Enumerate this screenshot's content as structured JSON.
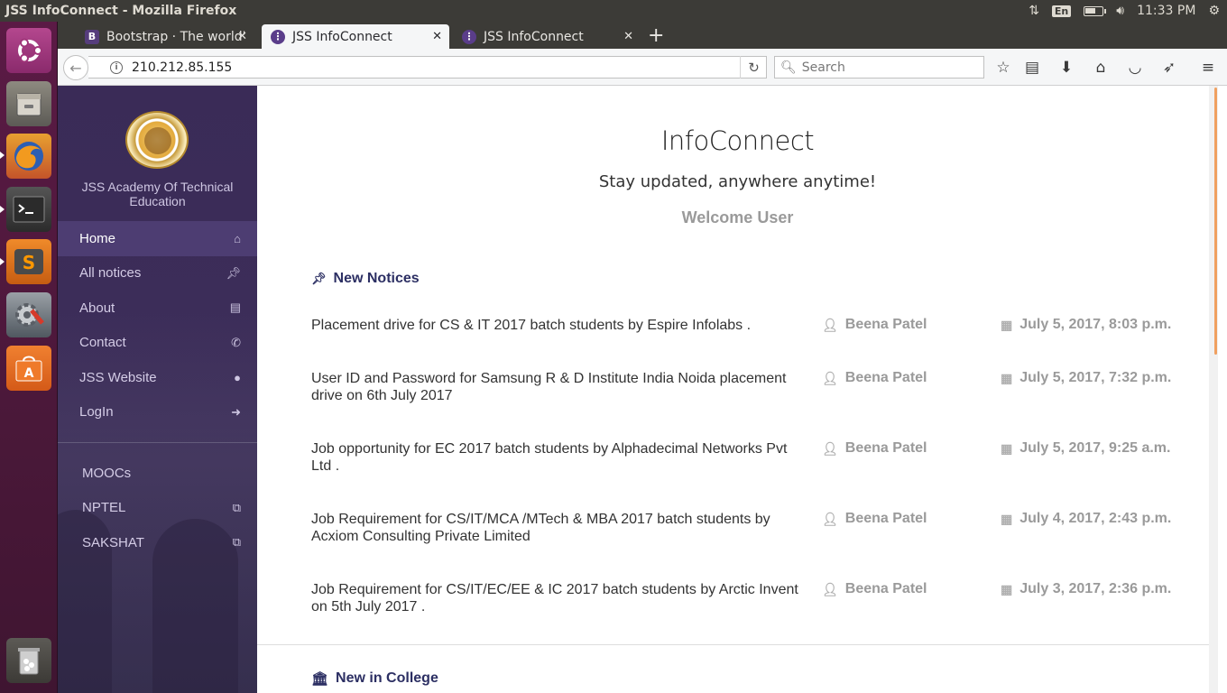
{
  "os_panel": {
    "window_title": "JSS InfoConnect - Mozilla Firefox",
    "keyboard_layout": "En",
    "battery_level": 0.7,
    "clock": "11:33 PM"
  },
  "launcher": {
    "items": [
      "ubuntu-dash",
      "files",
      "firefox",
      "terminal",
      "sublime-text",
      "system-settings",
      "software-center",
      "trash"
    ]
  },
  "browser": {
    "tabs": [
      {
        "label": "Bootstrap · The world'",
        "favicon": "B",
        "favicon_color": "#563d7c",
        "active": false
      },
      {
        "label": "JSS InfoConnect",
        "favicon": "",
        "favicon_color": "#5a3d8a",
        "active": true
      },
      {
        "label": "JSS InfoConnect",
        "favicon": "",
        "favicon_color": "#5a3d8a",
        "active": false
      }
    ],
    "url": "210.212.85.155",
    "search_placeholder": "Search"
  },
  "sidebar": {
    "institution": "JSS Academy Of Technical Education",
    "nav": [
      {
        "label": "Home",
        "icon": "home-icon",
        "active": true
      },
      {
        "label": "All notices",
        "icon": "pin-icon",
        "active": false
      },
      {
        "label": "About",
        "icon": "newspaper-icon",
        "active": false
      },
      {
        "label": "Contact",
        "icon": "phone-icon",
        "active": false
      },
      {
        "label": "JSS Website",
        "icon": "globe-icon",
        "active": false
      },
      {
        "label": "LogIn",
        "icon": "sign-in-icon",
        "active": false
      }
    ],
    "external": [
      {
        "label": "MOOCs",
        "icon": ""
      },
      {
        "label": "NPTEL",
        "icon": "external-link-icon"
      },
      {
        "label": "SAKSHAT",
        "icon": "external-link-icon"
      }
    ]
  },
  "main": {
    "brand": "InfoConnect",
    "tagline": "Stay updated, anywhere anytime!",
    "welcome": "Welcome User",
    "new_notices_heading": "New Notices",
    "notices": [
      {
        "title": "Placement drive for CS & IT 2017 batch students by Espire Infolabs .",
        "author": "Beena Patel",
        "date": "July 5, 2017, 8:03 p.m."
      },
      {
        "title": "User ID and Password for Samsung R & D Institute India Noida placement drive on 6th July 2017",
        "author": "Beena Patel",
        "date": "July 5, 2017, 7:32 p.m."
      },
      {
        "title": "Job opportunity for EC 2017 batch students by Alphadecimal Networks Pvt Ltd .",
        "author": "Beena Patel",
        "date": "July 5, 2017, 9:25 a.m."
      },
      {
        "title": "Job Requirement for CS/IT/MCA /MTech & MBA 2017 batch students by Acxiom Consulting Private Limited",
        "author": "Beena Patel",
        "date": "July 4, 2017, 2:43 p.m."
      },
      {
        "title": "Job Requirement for CS/IT/EC/EE & IC 2017 batch students by Arctic Invent on 5th July 2017 .",
        "author": "Beena Patel",
        "date": "July 3, 2017, 2:36 p.m."
      }
    ],
    "college_heading": "New in College"
  },
  "colors": {
    "sidebar_bg": "#3a2b57",
    "sidebar_active": "#4d3d72",
    "heading": "#2c2f63",
    "meta_gray": "#9a9a9a"
  }
}
